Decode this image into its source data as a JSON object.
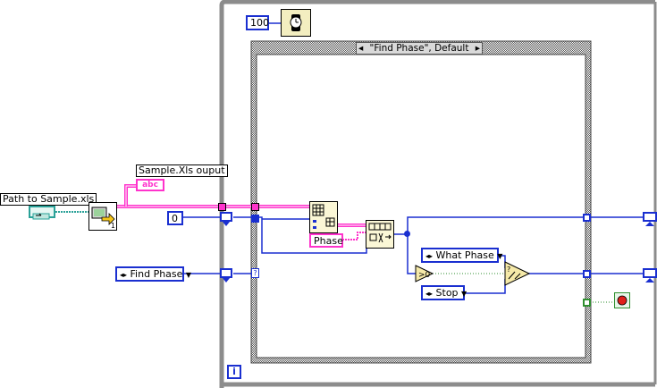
{
  "diagram": {
    "wait_constant": "100",
    "case_selector": "\"Find Phase\", Default",
    "path_label": "Path to Sample.xls",
    "output_label": "Sample.Xls ouput",
    "output_indicator_text": "abc",
    "zero_constant": "0",
    "phase_string": "Phase",
    "enum_find_phase": "Find Phase",
    "enum_what_phase": "What Phase",
    "enum_stop": "Stop",
    "loop_iteration": "i",
    "read_vi_badge": "1",
    "unknown_tunnel": "?"
  },
  "colors": {
    "string_wire": "#ff33cc",
    "numeric_wire": "#1a2fd0",
    "path_wire": "#2aa198",
    "bool_wire": "#2f8f2f",
    "structure_frame": "#8c8c8c",
    "node_bg": "#fbf7d6",
    "stop_button": "#e0201b"
  }
}
